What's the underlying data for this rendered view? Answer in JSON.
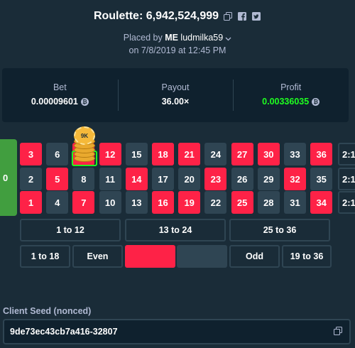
{
  "header": {
    "title": "Roulette: 6,942,524,999",
    "placed_prefix": "Placed by",
    "placed_me": "ME",
    "username": "ludmilka59",
    "date": "on 7/8/2019 at 12:45 PM"
  },
  "stats": {
    "bet_label": "Bet",
    "bet_value": "0.00009601",
    "payout_label": "Payout",
    "payout_value": "36.00×",
    "profit_label": "Profit",
    "profit_value": "0.00336035",
    "currency_symbol": "₿"
  },
  "board": {
    "zero": "0",
    "chip_label": "9K",
    "rows": [
      [
        {
          "n": "3",
          "c": "red"
        },
        {
          "n": "6",
          "c": "black"
        },
        {
          "n": "9",
          "c": "red"
        },
        {
          "n": "12",
          "c": "red"
        },
        {
          "n": "15",
          "c": "black"
        },
        {
          "n": "18",
          "c": "red"
        },
        {
          "n": "21",
          "c": "red"
        },
        {
          "n": "24",
          "c": "black"
        },
        {
          "n": "27",
          "c": "red"
        },
        {
          "n": "30",
          "c": "red"
        },
        {
          "n": "33",
          "c": "black"
        },
        {
          "n": "36",
          "c": "red"
        }
      ],
      [
        {
          "n": "2",
          "c": "black"
        },
        {
          "n": "5",
          "c": "red"
        },
        {
          "n": "8",
          "c": "black"
        },
        {
          "n": "11",
          "c": "black"
        },
        {
          "n": "14",
          "c": "red"
        },
        {
          "n": "17",
          "c": "black"
        },
        {
          "n": "20",
          "c": "black"
        },
        {
          "n": "23",
          "c": "red"
        },
        {
          "n": "26",
          "c": "black"
        },
        {
          "n": "29",
          "c": "black"
        },
        {
          "n": "32",
          "c": "red"
        },
        {
          "n": "35",
          "c": "black"
        }
      ],
      [
        {
          "n": "1",
          "c": "red"
        },
        {
          "n": "4",
          "c": "black"
        },
        {
          "n": "7",
          "c": "red"
        },
        {
          "n": "10",
          "c": "black"
        },
        {
          "n": "13",
          "c": "black"
        },
        {
          "n": "16",
          "c": "red"
        },
        {
          "n": "19",
          "c": "red"
        },
        {
          "n": "22",
          "c": "black"
        },
        {
          "n": "25",
          "c": "red"
        },
        {
          "n": "28",
          "c": "black"
        },
        {
          "n": "31",
          "c": "black"
        },
        {
          "n": "34",
          "c": "red"
        }
      ]
    ],
    "column_bets": [
      "2:1",
      "2:1",
      "2:1"
    ],
    "dozens": [
      "1 to 12",
      "13 to 24",
      "25 to 36"
    ],
    "low_label": "1 to 18",
    "even_label": "Even",
    "odd_label": "Odd",
    "high_label": "19 to 36"
  },
  "seed": {
    "label": "Client Seed (nonced)",
    "value": "9de73ec43cb7a416-32807"
  }
}
